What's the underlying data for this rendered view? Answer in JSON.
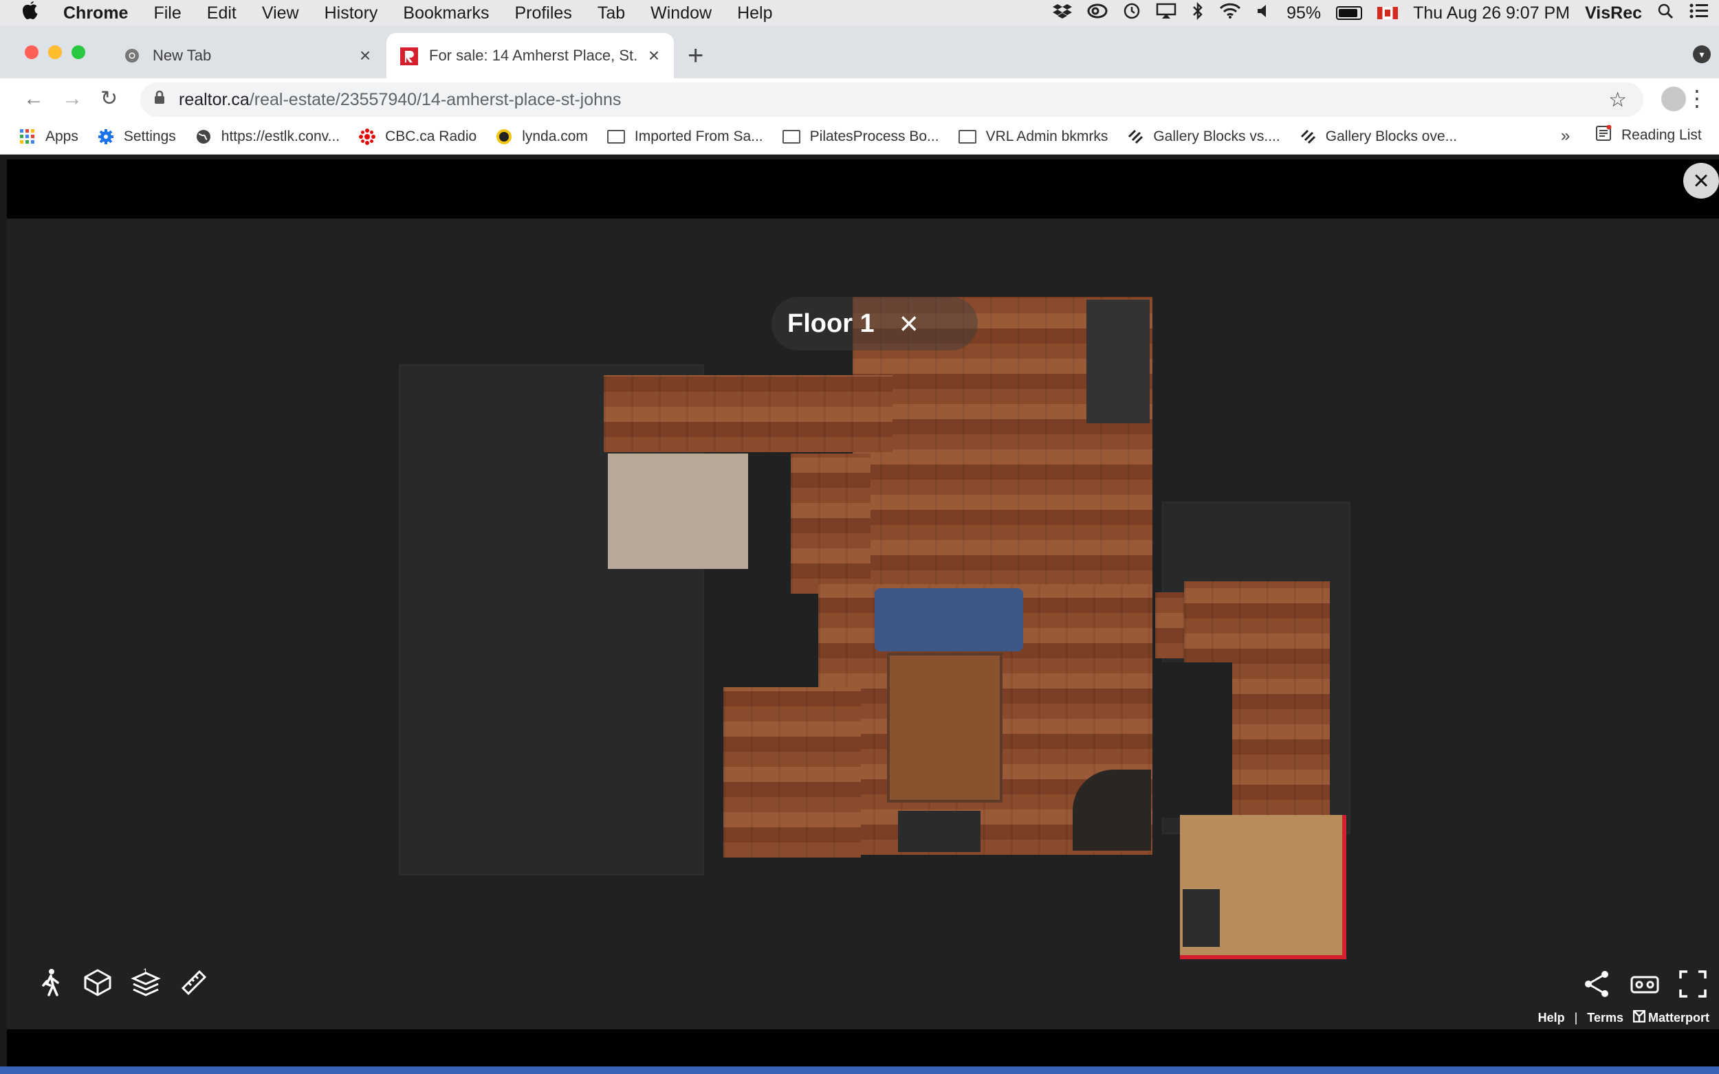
{
  "menubar": {
    "app": "Chrome",
    "items": [
      "File",
      "Edit",
      "View",
      "History",
      "Bookmarks",
      "Profiles",
      "Tab",
      "Window",
      "Help"
    ],
    "battery": "95%",
    "datetime": "Thu Aug 26  9:07 PM",
    "user": "VisRec"
  },
  "tabs": [
    {
      "label": "New Tab",
      "active": false
    },
    {
      "label": "For sale: 14 Amherst Place, St.",
      "active": true
    }
  ],
  "address": {
    "domain": "realtor.ca",
    "path": "/real-estate/23557940/14-amherst-place-st-johns"
  },
  "bookmarks": [
    {
      "label": "Apps",
      "icon": "apps-grid-icon"
    },
    {
      "label": "Settings",
      "icon": "gear-icon"
    },
    {
      "label": "https://estlk.conv...",
      "icon": "globe-icon"
    },
    {
      "label": "CBC.ca Radio",
      "icon": "cbc-icon"
    },
    {
      "label": "lynda.com",
      "icon": "lynda-icon"
    },
    {
      "label": "Imported From Sa...",
      "icon": "folder-icon"
    },
    {
      "label": "PilatesProcess Bo...",
      "icon": "folder-icon"
    },
    {
      "label": "VRL Admin bkmrks",
      "icon": "folder-icon"
    },
    {
      "label": "Gallery Blocks vs....",
      "icon": "squarespace-icon"
    },
    {
      "label": "Gallery Blocks ove...",
      "icon": "squarespace-icon"
    }
  ],
  "reading_list": "Reading List",
  "viewer": {
    "floor_label": "Floor 1",
    "floor_badge": "1",
    "links": {
      "help": "Help",
      "terms": "Terms",
      "brand": "Matterport"
    }
  },
  "colors": {
    "accent_red": "#d41f2c",
    "viewer_bg": "#202122"
  }
}
